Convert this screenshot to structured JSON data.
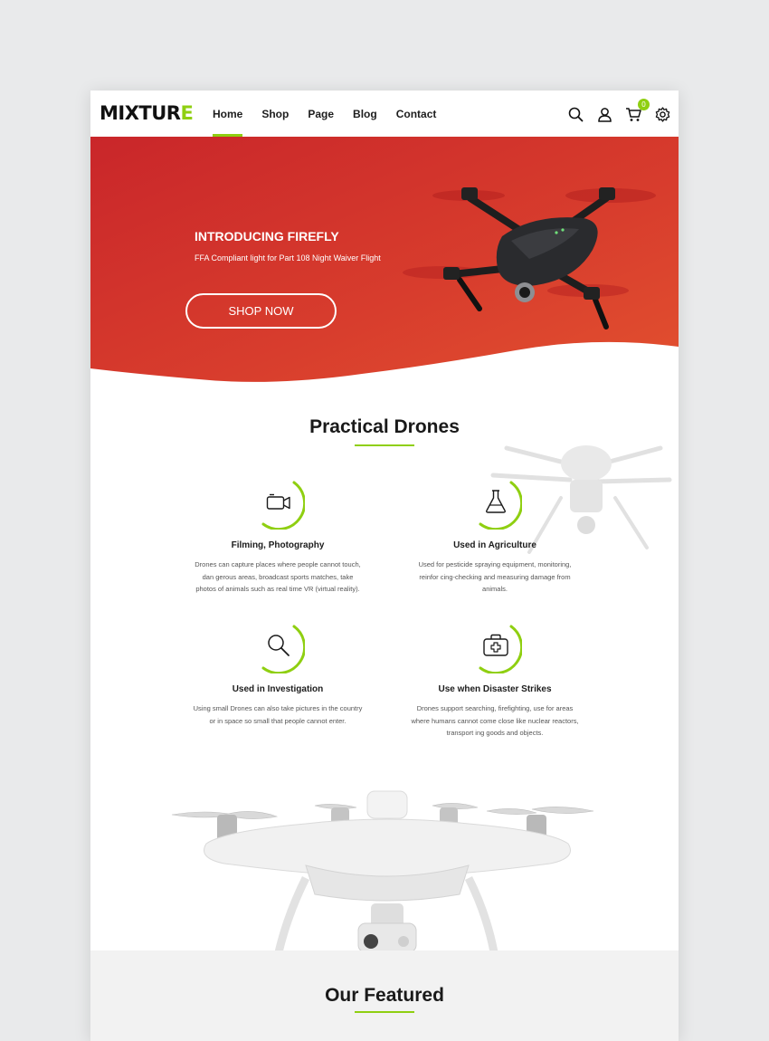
{
  "brand": {
    "logo_main": "MIXTUR",
    "logo_accent": "E",
    "accent_color": "#8fcf11",
    "hero_color": "#d63a2c"
  },
  "nav": [
    {
      "label": "Home",
      "active": true
    },
    {
      "label": "Shop"
    },
    {
      "label": "Page"
    },
    {
      "label": "Blog"
    },
    {
      "label": "Contact"
    }
  ],
  "header_icons": {
    "search": "search-icon",
    "account": "user-icon",
    "cart": "cart-icon",
    "cart_count": "0",
    "settings": "gear-icon"
  },
  "hero": {
    "title": "INTRODUCING FIREFLY",
    "subtitle": "FFA Compliant light for Part 108 Night Waiver Flight",
    "button_label": "SHOP NOW"
  },
  "features_section": {
    "title": "Practical Drones",
    "items": [
      {
        "icon": "video-camera-icon",
        "title": "Filming, Photography",
        "desc1": "Drones can capture places where people cannot touch,",
        "desc2": "dan gerous areas, broadcast sports matches, take",
        "desc3": "photos of animals such as real time VR (virtual reality)."
      },
      {
        "icon": "flask-icon",
        "title": "Used in Agriculture",
        "desc1": "Used for pesticide spraying equipment, monitoring,",
        "desc2": "reinfor cing-checking and measuring damage from",
        "desc3": "animals."
      },
      {
        "icon": "magnifier-icon",
        "title": "Used in Investigation",
        "desc1": "Using small Drones can also take pictures in the country",
        "desc2": "or in space so small that people cannot enter.",
        "desc3": ""
      },
      {
        "icon": "first-aid-icon",
        "title": "Use when Disaster Strikes",
        "desc1": "Drones support searching, firefighting, use for areas",
        "desc2": "where humans cannot come close like nuclear reactors,",
        "desc3": "transport ing goods and objects."
      }
    ]
  },
  "featured_section": {
    "title": "Our Featured"
  }
}
